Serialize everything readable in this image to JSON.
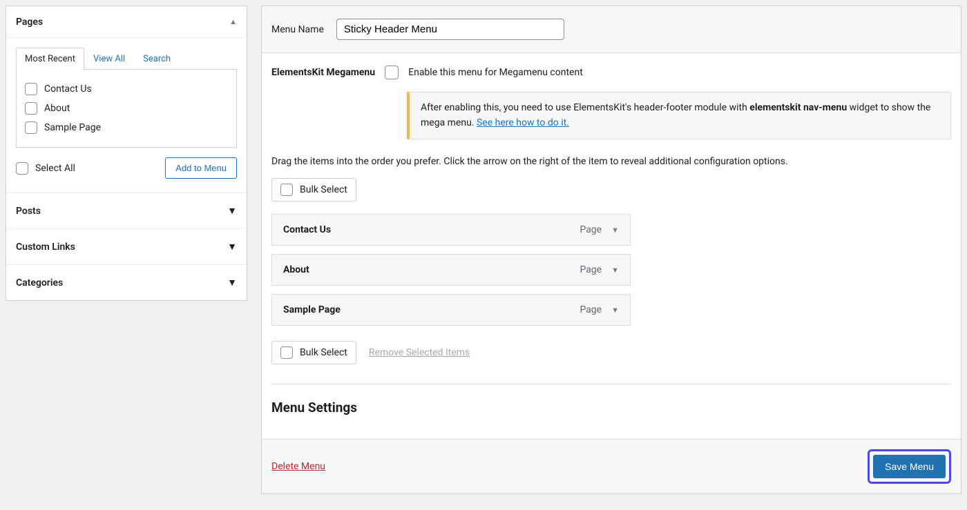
{
  "sidebar": {
    "pages": {
      "title": "Pages",
      "tabs": [
        "Most Recent",
        "View All",
        "Search"
      ],
      "items": [
        "Contact Us",
        "About",
        "Sample Page"
      ],
      "select_all": "Select All",
      "add_button": "Add to Menu"
    },
    "sections": [
      "Posts",
      "Custom Links",
      "Categories"
    ]
  },
  "menu_name": {
    "label": "Menu Name",
    "value": "Sticky Header Menu"
  },
  "megamenu": {
    "heading": "ElementsKit Megamenu",
    "enable_label": "Enable this menu for Megamenu content",
    "notice_pre": "After enabling this, you need to use ElementsKit's header-footer module with ",
    "notice_strong": "elementskit nav-menu",
    "notice_post": " widget to show the mega menu. ",
    "notice_link": "See here how to do it."
  },
  "instructions": "Drag the items into the order you prefer. Click the arrow on the right of the item to reveal additional configuration options.",
  "bulk_select": "Bulk Select",
  "remove_selected": "Remove Selected Items",
  "menu_items": [
    {
      "title": "Contact Us",
      "type": "Page"
    },
    {
      "title": "About",
      "type": "Page"
    },
    {
      "title": "Sample Page",
      "type": "Page"
    }
  ],
  "settings_heading": "Menu Settings",
  "delete_menu": "Delete Menu",
  "save_menu": "Save Menu"
}
